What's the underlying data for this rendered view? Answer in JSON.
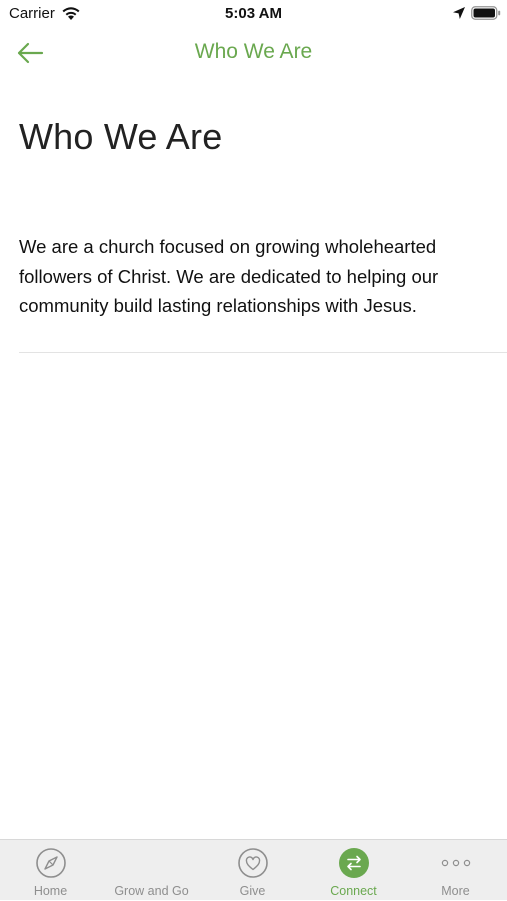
{
  "status_bar": {
    "carrier": "Carrier",
    "time": "5:03 AM",
    "icons": [
      "wifi-icon",
      "location-icon",
      "battery-icon"
    ]
  },
  "nav": {
    "back_icon": "arrow-left-icon",
    "title": "Who We Are"
  },
  "content": {
    "heading": "Who We Are",
    "body": "We are a church focused on growing wholehearted followers of Christ. We are dedicated to helping our community build lasting relationships with Jesus."
  },
  "tab_bar": {
    "tabs": [
      {
        "label": "Home",
        "icon": "compass-icon",
        "active": false
      },
      {
        "label": "Grow and Go",
        "icon": "",
        "active": false
      },
      {
        "label": "Give",
        "icon": "heart-icon",
        "active": false
      },
      {
        "label": "Connect",
        "icon": "arrows-swap-icon",
        "active": true
      },
      {
        "label": "More",
        "icon": "more-dots-icon",
        "active": false
      }
    ]
  },
  "colors": {
    "accent": "#6aa84f",
    "tab_inactive": "#8e8e8e",
    "tab_bar_bg": "#eeeeee"
  }
}
